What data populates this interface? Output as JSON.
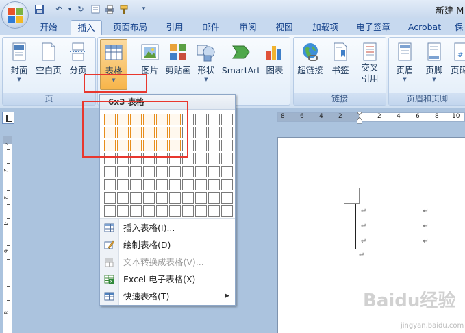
{
  "window": {
    "title": "新建 M"
  },
  "tabs": [
    {
      "label": "开始",
      "active": false
    },
    {
      "label": "插入",
      "active": true
    },
    {
      "label": "页面布局",
      "active": false
    },
    {
      "label": "引用",
      "active": false
    },
    {
      "label": "邮件",
      "active": false
    },
    {
      "label": "审阅",
      "active": false
    },
    {
      "label": "视图",
      "active": false
    },
    {
      "label": "加载项",
      "active": false
    },
    {
      "label": "电子签章",
      "active": false
    },
    {
      "label": "Acrobat",
      "active": false
    },
    {
      "label": "保",
      "active": false
    }
  ],
  "ribbon": {
    "groups": {
      "pages": "页",
      "links": "链接",
      "header_footer": "页眉和页脚"
    },
    "buttons": {
      "cover": "封面",
      "blank_page": "空白页",
      "page_break": "分页",
      "table": "表格",
      "picture": "图片",
      "clip_art": "剪贴画",
      "shapes": "形状",
      "smartart": "SmartArt",
      "chart": "图表",
      "hyperlink": "超链接",
      "bookmark": "书签",
      "cross_ref_line1": "交叉",
      "cross_ref_line2": "引用",
      "header": "页眉",
      "footer": "页脚",
      "page_num": "页码"
    }
  },
  "table_menu": {
    "header": "6x3 表格",
    "grid": {
      "rows": 8,
      "cols": 10,
      "selected_rows": 3,
      "selected_cols": 6
    },
    "items": [
      {
        "label": "插入表格(I)...",
        "disabled": false,
        "submenu": false
      },
      {
        "label": "绘制表格(D)",
        "disabled": false,
        "submenu": false
      },
      {
        "label": "文本转换成表格(V)...",
        "disabled": true,
        "submenu": false
      },
      {
        "label": "Excel 电子表格(X)",
        "disabled": false,
        "submenu": false
      },
      {
        "label": "快速表格(T)",
        "disabled": false,
        "submenu": true
      }
    ]
  },
  "h_ruler": {
    "labels": [
      "8",
      "6",
      "4",
      "2",
      "2",
      "4",
      "6",
      "8",
      "10"
    ]
  },
  "v_ruler": {
    "labels": [
      "4",
      "2",
      "2",
      "4",
      "6",
      "8"
    ]
  },
  "document": {
    "para_mark": "↵",
    "table_rows": 3,
    "table_cols": 2
  },
  "watermark": {
    "text": "Baidu经验",
    "sub": "jingyan.baidu.com"
  },
  "colors": {
    "accent_orange": "#f7b54a",
    "highlight_red": "#e8372e",
    "ribbon_bg": "#dde9f6"
  }
}
